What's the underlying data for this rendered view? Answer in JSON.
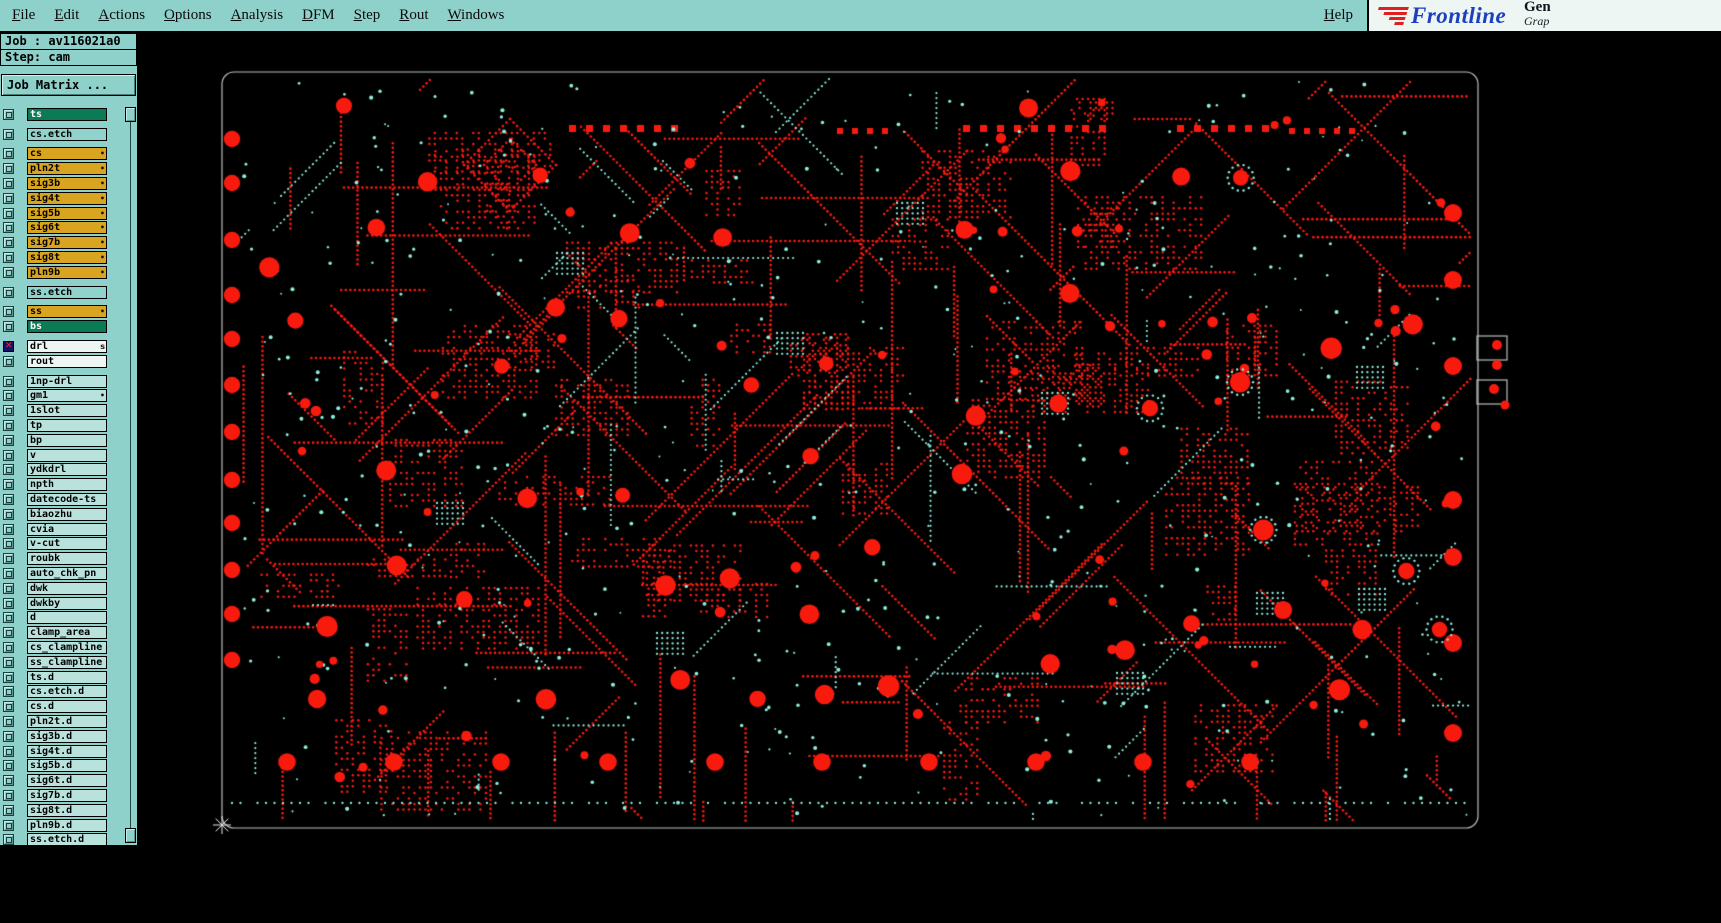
{
  "menu_bar": {
    "items": [
      {
        "label": "File"
      },
      {
        "label": "Edit"
      },
      {
        "label": "Actions"
      },
      {
        "label": "Options"
      },
      {
        "label": "Analysis"
      },
      {
        "label": "DFM"
      },
      {
        "label": "Step"
      },
      {
        "label": "Rout"
      },
      {
        "label": "Windows"
      }
    ],
    "help_label": "Help"
  },
  "logo": {
    "brand": "Frontline",
    "fragment_top": "Gen",
    "fragment_bottom": "Grap"
  },
  "job_panel": {
    "job_line": "Job : av116021a0",
    "step_line": "Step: cam",
    "matrix_button": "Job Matrix ..."
  },
  "layers": [
    {
      "name": "ts",
      "style": "green",
      "marker": "",
      "gap": false,
      "checkbox": "normal"
    },
    {
      "name": "cs.etch",
      "style": "teal",
      "marker": "",
      "gap": true,
      "checkbox": "normal"
    },
    {
      "name": "cs",
      "style": "gold",
      "marker": "dot",
      "gap": true,
      "checkbox": "normal"
    },
    {
      "name": "pln2t",
      "style": "gold",
      "marker": "dot",
      "gap": false,
      "checkbox": "normal"
    },
    {
      "name": "sig3b",
      "style": "gold",
      "marker": "dot",
      "gap": false,
      "checkbox": "normal"
    },
    {
      "name": "sig4t",
      "style": "gold",
      "marker": "dot",
      "gap": false,
      "checkbox": "normal"
    },
    {
      "name": "sig5b",
      "style": "gold",
      "marker": "dot",
      "gap": false,
      "checkbox": "normal"
    },
    {
      "name": "sig6t",
      "style": "gold",
      "marker": "dot",
      "gap": false,
      "checkbox": "normal"
    },
    {
      "name": "sig7b",
      "style": "gold",
      "marker": "dot",
      "gap": false,
      "checkbox": "normal"
    },
    {
      "name": "sig8t",
      "style": "gold",
      "marker": "dot",
      "gap": false,
      "checkbox": "normal"
    },
    {
      "name": "pln9b",
      "style": "gold",
      "marker": "dot",
      "gap": false,
      "checkbox": "normal"
    },
    {
      "name": "ss.etch",
      "style": "teal",
      "marker": "",
      "gap": true,
      "checkbox": "normal"
    },
    {
      "name": "ss",
      "style": "gold",
      "marker": "dot",
      "gap": true,
      "checkbox": "normal"
    },
    {
      "name": "bs",
      "style": "green",
      "marker": "",
      "gap": false,
      "checkbox": "normal"
    },
    {
      "name": "drl",
      "style": "white",
      "marker": "s",
      "gap": true,
      "checkbox": "redx"
    },
    {
      "name": "rout",
      "style": "white",
      "marker": "",
      "gap": false,
      "checkbox": "normal"
    },
    {
      "name": "1np-drl",
      "style": "plain",
      "marker": "",
      "gap": true,
      "checkbox": "normal"
    },
    {
      "name": "gm1",
      "style": "plain",
      "marker": "dot",
      "gap": false,
      "checkbox": "normal"
    },
    {
      "name": "1slot",
      "style": "plain",
      "marker": "",
      "gap": false,
      "checkbox": "normal"
    },
    {
      "name": "tp",
      "style": "plain",
      "marker": "",
      "gap": false,
      "checkbox": "normal"
    },
    {
      "name": "bp",
      "style": "plain",
      "marker": "",
      "gap": false,
      "checkbox": "normal"
    },
    {
      "name": "v",
      "style": "plain",
      "marker": "",
      "gap": false,
      "checkbox": "normal"
    },
    {
      "name": "ydkdrl",
      "style": "plain",
      "marker": "",
      "gap": false,
      "checkbox": "normal"
    },
    {
      "name": "npth",
      "style": "plain",
      "marker": "",
      "gap": false,
      "checkbox": "normal"
    },
    {
      "name": "datecode-ts",
      "style": "plain",
      "marker": "",
      "gap": false,
      "checkbox": "normal"
    },
    {
      "name": "biaozhu",
      "style": "plain",
      "marker": "",
      "gap": false,
      "checkbox": "normal"
    },
    {
      "name": "cvia",
      "style": "plain",
      "marker": "",
      "gap": false,
      "checkbox": "normal"
    },
    {
      "name": "v-cut",
      "style": "plain",
      "marker": "",
      "gap": false,
      "checkbox": "normal"
    },
    {
      "name": "roubk",
      "style": "plain",
      "marker": "",
      "gap": false,
      "checkbox": "normal"
    },
    {
      "name": "auto_chk_pn",
      "style": "plain",
      "marker": "",
      "gap": false,
      "checkbox": "normal"
    },
    {
      "name": "dwk",
      "style": "plain",
      "marker": "",
      "gap": false,
      "checkbox": "normal"
    },
    {
      "name": "dwkby",
      "style": "plain",
      "marker": "",
      "gap": false,
      "checkbox": "normal"
    },
    {
      "name": "d",
      "style": "plain",
      "marker": "",
      "gap": false,
      "checkbox": "normal"
    },
    {
      "name": "clamp_area",
      "style": "plain",
      "marker": "",
      "gap": false,
      "checkbox": "normal"
    },
    {
      "name": "cs_clampline",
      "style": "plain",
      "marker": "",
      "gap": false,
      "checkbox": "normal"
    },
    {
      "name": "ss_clampline",
      "style": "plain",
      "marker": "",
      "gap": false,
      "checkbox": "normal"
    },
    {
      "name": "ts.d",
      "style": "plain",
      "marker": "",
      "gap": false,
      "checkbox": "normal"
    },
    {
      "name": "cs.etch.d",
      "style": "plain",
      "marker": "",
      "gap": false,
      "checkbox": "normal"
    },
    {
      "name": "cs.d",
      "style": "plain",
      "marker": "",
      "gap": false,
      "checkbox": "normal"
    },
    {
      "name": "pln2t.d",
      "style": "plain",
      "marker": "",
      "gap": false,
      "checkbox": "normal"
    },
    {
      "name": "sig3b.d",
      "style": "plain",
      "marker": "",
      "gap": false,
      "checkbox": "normal"
    },
    {
      "name": "sig4t.d",
      "style": "plain",
      "marker": "",
      "gap": false,
      "checkbox": "normal"
    },
    {
      "name": "sig5b.d",
      "style": "plain",
      "marker": "",
      "gap": false,
      "checkbox": "normal"
    },
    {
      "name": "sig6t.d",
      "style": "plain",
      "marker": "",
      "gap": false,
      "checkbox": "normal"
    },
    {
      "name": "sig7b.d",
      "style": "plain",
      "marker": "",
      "gap": false,
      "checkbox": "normal"
    },
    {
      "name": "sig8t.d",
      "style": "plain",
      "marker": "",
      "gap": false,
      "checkbox": "normal"
    },
    {
      "name": "pln9b.d",
      "style": "plain",
      "marker": "",
      "gap": false,
      "checkbox": "normal"
    },
    {
      "name": "ss.etch.d",
      "style": "plain",
      "marker": "",
      "gap": false,
      "checkbox": "normal"
    }
  ],
  "colors": {
    "panel_teal": "#8ed1cb",
    "menu_teal": "#8ed1cb",
    "logo_area_bg": "#eef6f4",
    "canvas_bg": "#000000",
    "pad_red": "#f91a0e",
    "drill_cyan": "#8deedd",
    "board_outline": "#b8bfbc",
    "row_gold": "#d9a41f",
    "row_green": "#0b7b55",
    "row_teal": "#8fd3cc",
    "row_plain": "#b9e2dc",
    "row_white": "#eef6f4",
    "logo_blue": "#1b3fbf",
    "logo_red": "#e02020",
    "crosshair": "#e8e8e8"
  }
}
